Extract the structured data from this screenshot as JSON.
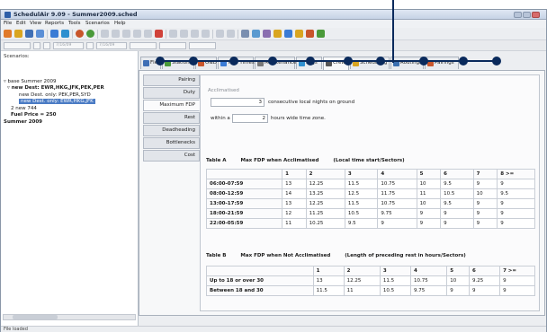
{
  "window": {
    "title": "SchedulAir 9.09 - Summer2009.sched"
  },
  "menubar": [
    "File",
    "Edit",
    "View",
    "Reports",
    "Tools",
    "Scenarios",
    "Help"
  ],
  "scenarios": {
    "label": "Scenarios:",
    "tree": [
      {
        "label": "base Summer 2009",
        "level": 0
      },
      {
        "label": "new Dest: EWR,HKG,JFK,PEK,PER",
        "level": 1,
        "bold": true
      },
      {
        "label": "new Dest. only: PEK,PER,SYD",
        "level": 2
      },
      {
        "label": "new Dest. only: EWR,HKG,JFK",
        "level": 2,
        "selected": true
      },
      {
        "label": "2 new 744",
        "level": 1
      },
      {
        "label": "Fuel Price = 250",
        "level": 1,
        "bold": true
      },
      {
        "label": "Summer 2009",
        "level": 0,
        "bold": true
      }
    ]
  },
  "tabs": [
    {
      "label": "Fleet",
      "color": "#3f6fb5"
    },
    {
      "label": "Stations",
      "color": "#4a9a3a"
    },
    {
      "label": "O&D",
      "color": "#c8552b"
    },
    {
      "label": "Turn Times",
      "color": "#3a7bd5"
    },
    {
      "label": "Maintenance",
      "color": "#777777"
    },
    {
      "label": "Legs",
      "color": "#2e8fcf"
    },
    {
      "label": "Crew",
      "color": "#555555",
      "active": true
    },
    {
      "label": "Scheduling",
      "color": "#d9a520"
    },
    {
      "label": "Routings",
      "color": "#3a6fb0"
    },
    {
      "label": "Pairings",
      "color": "#c8552b"
    }
  ],
  "subtabs": [
    "Pairing",
    "Duty",
    "Maximum FDP",
    "Rest",
    "Deadheading",
    "Bottlenecks",
    "Cost"
  ],
  "active_subtab": "Maximum FDP",
  "acclimatised": {
    "title": "Acclimatised",
    "nights_value": "3",
    "nights_text": "consecutive local nights on ground",
    "within_label": "within a",
    "hours_value": "2",
    "hours_text": "hours wide time zone."
  },
  "table_a": {
    "caption_id": "Table A",
    "caption_title": "Max FDP when Acclimatised",
    "caption_note": "(Local time start/Sectors)",
    "columns": [
      "1",
      "2",
      "3",
      "4",
      "5",
      "6",
      "7",
      "8 >="
    ],
    "rows": [
      {
        "label": "06:00-07:59",
        "values": [
          "13",
          "12.25",
          "11.5",
          "10.75",
          "10",
          "9.5",
          "9",
          "9"
        ]
      },
      {
        "label": "08:00-12:59",
        "values": [
          "14",
          "13.25",
          "12.5",
          "11.75",
          "11",
          "10.5",
          "10",
          "9.5"
        ]
      },
      {
        "label": "13:00-17:59",
        "values": [
          "13",
          "12.25",
          "11.5",
          "10.75",
          "10",
          "9.5",
          "9",
          "9"
        ]
      },
      {
        "label": "18:00-21:59",
        "values": [
          "12",
          "11.25",
          "10.5",
          "9.75",
          "9",
          "9",
          "9",
          "9"
        ]
      },
      {
        "label": "22:00-05:59",
        "values": [
          "11",
          "10.25",
          "9.5",
          "9",
          "9",
          "9",
          "9",
          "9"
        ]
      }
    ]
  },
  "table_b": {
    "caption_id": "Table B",
    "caption_title": "Max FDP when Not Acclimatised",
    "caption_note": "(Length of preceding rest in hours/Sectors)",
    "columns": [
      "1",
      "2",
      "3",
      "4",
      "5",
      "6",
      "7 >="
    ],
    "rows": [
      {
        "label": "Up to 18 or over 30",
        "values": [
          "13",
          "12.25",
          "11.5",
          "10.75",
          "10",
          "9.25",
          "9"
        ]
      },
      {
        "label": "Between 18 and 30",
        "values": [
          "11.5",
          "11",
          "10.5",
          "9.75",
          "9",
          "9",
          "9"
        ]
      }
    ]
  },
  "status": {
    "text": "File loaded"
  },
  "secondbar": {
    "date1": "7/16/09",
    "date2": "7/16/09"
  }
}
